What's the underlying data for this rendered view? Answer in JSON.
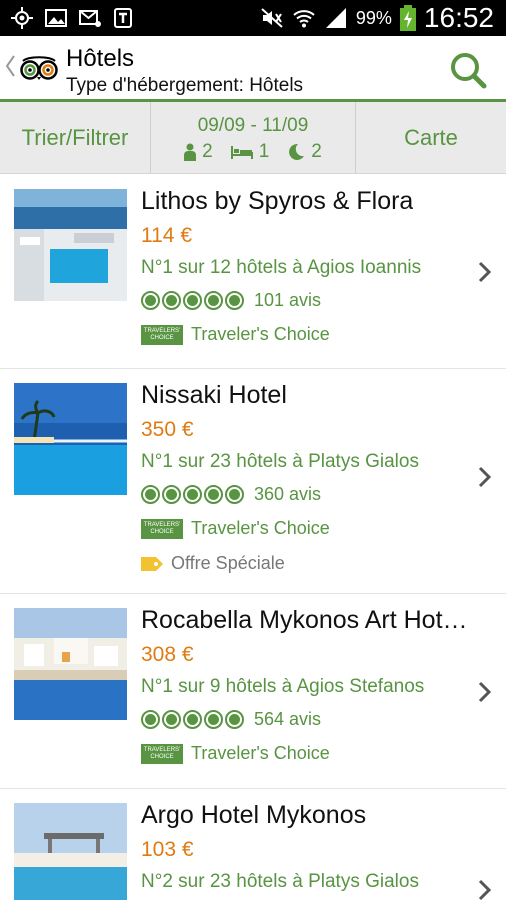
{
  "status_bar": {
    "battery": "99%",
    "time": "16:52"
  },
  "header": {
    "title": "Hôtels",
    "subtitle": "Type d'hébergement: Hôtels"
  },
  "filter_bar": {
    "sort_label": "Trier/Filtrer",
    "dates": "09/09 - 11/09",
    "guests": "2",
    "rooms": "1",
    "nights": "2",
    "map_label": "Carte"
  },
  "colors": {
    "accent_green": "#589442",
    "price_orange": "#e07b12"
  },
  "hotels": [
    {
      "name": "Lithos by Spyros & Flora",
      "price": "114 €",
      "rank": "N°1 sur 12 hôtels à Agios Ioannis",
      "rating_bubbles": 5,
      "reviews": "101 avis",
      "award": "Traveler's Choice",
      "award_badge": "TRAVELERS' CHOICE"
    },
    {
      "name": "Nissaki Hotel",
      "price": "350 €",
      "rank": "N°1 sur 23 hôtels à Platys Gialos",
      "rating_bubbles": 5,
      "reviews": "360 avis",
      "award": "Traveler's Choice",
      "award_badge": "TRAVELERS' CHOICE",
      "offer": "Offre Spéciale"
    },
    {
      "name": "Rocabella Mykonos Art Hot…",
      "price": "308 €",
      "rank": "N°1 sur 9 hôtels à Agios Stefanos",
      "rating_bubbles": 5,
      "reviews": "564 avis",
      "award": "Traveler's Choice",
      "award_badge": "TRAVELERS' CHOICE"
    },
    {
      "name": "Argo Hotel Mykonos",
      "price": "103 €",
      "rank": "N°2 sur 23 hôtels à Platys Gialos"
    }
  ]
}
